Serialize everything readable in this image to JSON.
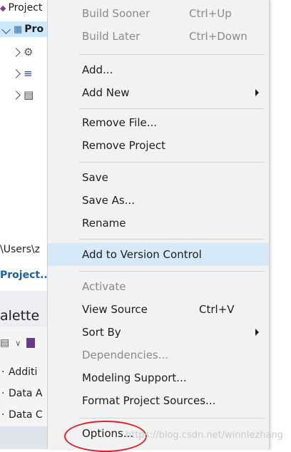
{
  "tree": {
    "row1": "Project",
    "row2": "Pro",
    "path": "\\Users\\z",
    "link": "Project..."
  },
  "palette": {
    "title": "alette",
    "items": [
      "Additi",
      "Data A",
      "Data C"
    ]
  },
  "menu": {
    "items": [
      {
        "label": "Build Sooner",
        "shortcut": "Ctrl+Up",
        "disabled": true
      },
      {
        "label": "Build Later",
        "shortcut": "Ctrl+Down",
        "disabled": true
      },
      {
        "label": "Add...",
        "shortcut": "",
        "disabled": false
      },
      {
        "label": "Add New",
        "shortcut": "",
        "disabled": false,
        "submenu": true
      },
      {
        "label": "Remove File...",
        "shortcut": "",
        "disabled": false
      },
      {
        "label": "Remove Project",
        "shortcut": "",
        "disabled": false
      },
      {
        "label": "Save",
        "shortcut": "",
        "disabled": false
      },
      {
        "label": "Save As...",
        "shortcut": "",
        "disabled": false
      },
      {
        "label": "Rename",
        "shortcut": "",
        "disabled": false
      },
      {
        "label": "Add to Version Control",
        "shortcut": "",
        "disabled": false,
        "highlighted": true
      },
      {
        "label": "Activate",
        "shortcut": "",
        "disabled": true
      },
      {
        "label": "View Source",
        "shortcut": "Ctrl+V",
        "disabled": false
      },
      {
        "label": "Sort By",
        "shortcut": "",
        "disabled": false,
        "submenu": true
      },
      {
        "label": "Dependencies...",
        "shortcut": "",
        "disabled": true
      },
      {
        "label": "Modeling Support...",
        "shortcut": "",
        "disabled": false
      },
      {
        "label": "Format Project Sources...",
        "shortcut": "",
        "disabled": false
      },
      {
        "label": "Options...",
        "shortcut": "",
        "disabled": false
      }
    ]
  },
  "watermark": "https://blog.csdn.net/winnlezhang",
  "colors": {
    "highlight": "#d6e9f9",
    "annotation_circle": "#d6242b",
    "link": "#1a5ea8"
  }
}
